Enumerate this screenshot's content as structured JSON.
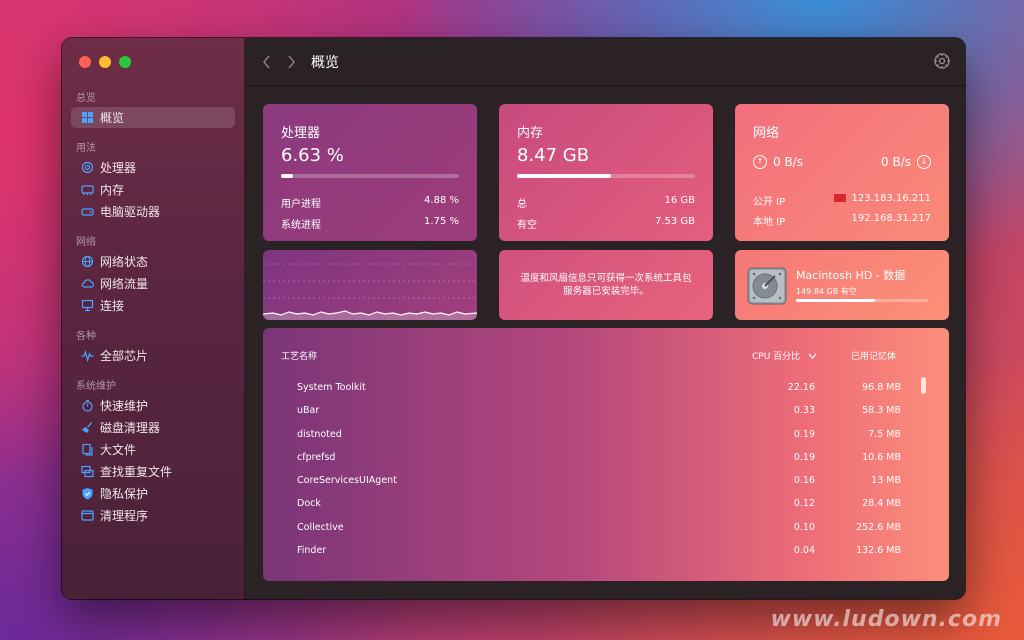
{
  "sidebar": {
    "sections": [
      {
        "title": "总览",
        "items": [
          {
            "label": "概览",
            "icon": "grid-icon",
            "active": true
          }
        ]
      },
      {
        "title": "用法",
        "items": [
          {
            "label": "处理器",
            "icon": "cpu-icon"
          },
          {
            "label": "内存",
            "icon": "memory-icon"
          },
          {
            "label": "电脑驱动器",
            "icon": "drive-icon"
          }
        ]
      },
      {
        "title": "网络",
        "items": [
          {
            "label": "网络状态",
            "icon": "globe-icon"
          },
          {
            "label": "网络流量",
            "icon": "cloud-icon"
          },
          {
            "label": "连接",
            "icon": "monitor-icon"
          }
        ]
      },
      {
        "title": "各种",
        "items": [
          {
            "label": "全部芯片",
            "icon": "pulse-icon"
          }
        ]
      },
      {
        "title": "系统维护",
        "items": [
          {
            "label": "快速维护",
            "icon": "stopwatch-icon"
          },
          {
            "label": "磁盘清理器",
            "icon": "broom-icon"
          },
          {
            "label": "大文件",
            "icon": "files-icon"
          },
          {
            "label": "查找重复文件",
            "icon": "duplicate-icon"
          },
          {
            "label": "隐私保护",
            "icon": "shield-icon"
          },
          {
            "label": "清理程序",
            "icon": "app-icon"
          }
        ]
      }
    ]
  },
  "toolbar": {
    "title": "概览"
  },
  "cpu": {
    "title": "处理器",
    "value": "6.63 %",
    "usage_fraction": 0.0663,
    "user_label": "用户进程",
    "user_value": "4.88 %",
    "system_label": "系统进程",
    "system_value": "1.75 %"
  },
  "memory": {
    "title": "内存",
    "value": "8.47 GB",
    "usage_fraction": 0.53,
    "total_label": "总",
    "total_value": "16 GB",
    "free_label": "有空",
    "free_value": "7.53 GB"
  },
  "network": {
    "title": "网络",
    "down": "0 B/s",
    "up": "0 B/s",
    "public_ip_label": "公开 IP",
    "public_ip": "123.183.16.211",
    "local_ip_label": "本地 IP",
    "local_ip": "192.168.31.217"
  },
  "info": {
    "line1": "温度和风扇信息只可获得一次系统工具包",
    "line2": "服务器已安装完毕。"
  },
  "disk": {
    "name": "Macintosh HD - 数据",
    "available": "149.84 GB 有空",
    "used_fraction": 0.6
  },
  "processes": {
    "col_name": "工艺名称",
    "col_cpu": "CPU 百分比",
    "col_mem": "已用记忆体",
    "rows": [
      {
        "name": "System Toolkit",
        "cpu": "22.16",
        "mem": "96.8 MB"
      },
      {
        "name": "uBar",
        "cpu": "0.33",
        "mem": "58.3 MB"
      },
      {
        "name": "distnoted",
        "cpu": "0.19",
        "mem": "7.5 MB"
      },
      {
        "name": "cfprefsd",
        "cpu": "0.19",
        "mem": "10.6 MB"
      },
      {
        "name": "CoreServicesUIAgent",
        "cpu": "0.16",
        "mem": "13 MB"
      },
      {
        "name": "Dock",
        "cpu": "0.12",
        "mem": "28.4 MB"
      },
      {
        "name": "Collective",
        "cpu": "0.10",
        "mem": "252.6 MB"
      },
      {
        "name": "Finder",
        "cpu": "0.04",
        "mem": "132.6 MB"
      }
    ]
  },
  "watermark": "www.ludown.com"
}
